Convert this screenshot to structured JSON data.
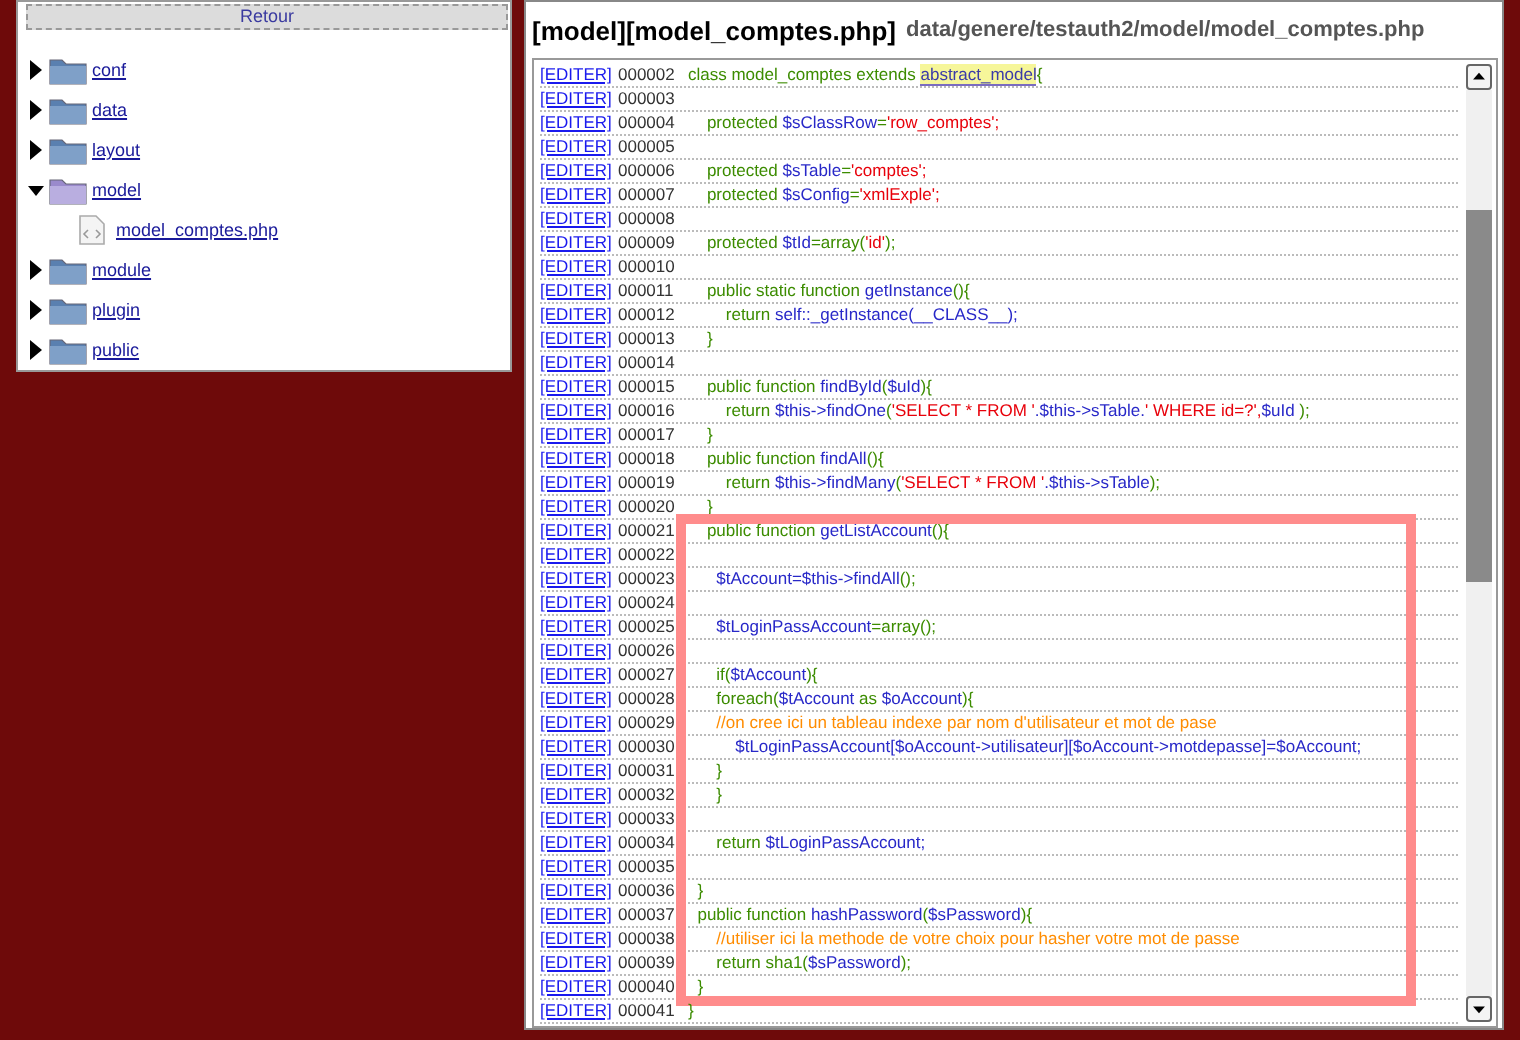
{
  "sidebar": {
    "back_button": "Retour",
    "items": [
      {
        "label": "conf",
        "kind": "folder",
        "expanded": false
      },
      {
        "label": "data",
        "kind": "folder",
        "expanded": false
      },
      {
        "label": "layout",
        "kind": "folder",
        "expanded": false
      },
      {
        "label": "model",
        "kind": "folder",
        "expanded": true,
        "children": [
          {
            "label": "model_comptes.php",
            "kind": "file"
          }
        ]
      },
      {
        "label": "module",
        "kind": "folder",
        "expanded": false
      },
      {
        "label": "plugin",
        "kind": "folder",
        "expanded": false
      },
      {
        "label": "public",
        "kind": "folder",
        "expanded": false
      }
    ]
  },
  "editor": {
    "title": "[model][model_comptes.php]",
    "path": "data/genere/testauth2/model/model_comptes.php",
    "lines": [
      {
        "edit_link": "[EDITER]",
        "number": "000002",
        "highlighted": false,
        "code": [
          {
            "text": "class model_comptes extends ",
            "color": "#3c8c00"
          },
          {
            "text": "abstract_model",
            "marked": true
          },
          {
            "text": "{",
            "color": "#3c8c00"
          }
        ]
      },
      {
        "edit_link": "[EDITER]",
        "number": "000003",
        "highlighted": false
      },
      {
        "edit_link": "[EDITER]",
        "number": "000004",
        "highlighted": false,
        "code": [
          {
            "text": "    protected ",
            "color": "#3c8c00"
          },
          {
            "text": "$sClassRow",
            "color": "#2828c8"
          },
          {
            "text": "=",
            "color": "#3c8c00"
          },
          {
            "text": "'row_comptes';",
            "color": "#e8000a"
          }
        ]
      },
      {
        "edit_link": "[EDITER]",
        "number": "000005",
        "highlighted": false
      },
      {
        "edit_link": "[EDITER]",
        "number": "000006",
        "highlighted": false,
        "code": [
          {
            "text": "    protected ",
            "color": "#3c8c00"
          },
          {
            "text": "$sTable",
            "color": "#2828c8"
          },
          {
            "text": "=",
            "color": "#3c8c00"
          },
          {
            "text": "'comptes';",
            "color": "#e8000a"
          }
        ]
      },
      {
        "edit_link": "[EDITER]",
        "number": "000007",
        "highlighted": false,
        "code": [
          {
            "text": "    protected ",
            "color": "#3c8c00"
          },
          {
            "text": "$sConfig",
            "color": "#2828c8"
          },
          {
            "text": "=",
            "color": "#3c8c00"
          },
          {
            "text": "'xmlExple';",
            "color": "#e8000a"
          }
        ]
      },
      {
        "edit_link": "[EDITER]",
        "number": "000008",
        "highlighted": false
      },
      {
        "edit_link": "[EDITER]",
        "number": "000009",
        "highlighted": false,
        "code": [
          {
            "text": "    protected ",
            "color": "#3c8c00"
          },
          {
            "text": "$tId",
            "color": "#2828c8"
          },
          {
            "text": "=array(",
            "color": "#3c8c00"
          },
          {
            "text": "'id'",
            "color": "#e8000a"
          },
          {
            "text": ");",
            "color": "#3c8c00"
          }
        ]
      },
      {
        "edit_link": "[EDITER]",
        "number": "000010",
        "highlighted": false
      },
      {
        "edit_link": "[EDITER]",
        "number": "000011",
        "highlighted": false,
        "code": [
          {
            "text": "    public static function ",
            "color": "#3c8c00"
          },
          {
            "text": "getInstance",
            "color": "#2828c8"
          },
          {
            "text": "(){",
            "color": "#3c8c00"
          }
        ]
      },
      {
        "edit_link": "[EDITER]",
        "number": "000012",
        "highlighted": false,
        "code": [
          {
            "text": "        return ",
            "color": "#3c8c00"
          },
          {
            "text": "self::_getInstance(__CLASS__);",
            "color": "#2828c8"
          }
        ]
      },
      {
        "edit_link": "[EDITER]",
        "number": "000013",
        "highlighted": false,
        "code": [
          {
            "text": "    }",
            "color": "#3c8c00"
          }
        ]
      },
      {
        "edit_link": "[EDITER]",
        "number": "000014",
        "highlighted": false
      },
      {
        "edit_link": "[EDITER]",
        "number": "000015",
        "highlighted": false,
        "code": [
          {
            "text": "    public function ",
            "color": "#3c8c00"
          },
          {
            "text": "findById",
            "color": "#2828c8"
          },
          {
            "text": "(",
            "color": "#3c8c00"
          },
          {
            "text": "$uId",
            "color": "#2828c8"
          },
          {
            "text": "){",
            "color": "#3c8c00"
          }
        ]
      },
      {
        "edit_link": "[EDITER]",
        "number": "000016",
        "highlighted": false,
        "code": [
          {
            "text": "        return ",
            "color": "#3c8c00"
          },
          {
            "text": "$this->findOne",
            "color": "#2828c8"
          },
          {
            "text": "(",
            "color": "#3c8c00"
          },
          {
            "text": "'SELECT * FROM '",
            "color": "#e8000a"
          },
          {
            "text": ".$this->sTable.",
            "color": "#2828c8"
          },
          {
            "text": "' WHERE id=?',",
            "color": "#e8000a"
          },
          {
            "text": "$uId",
            "color": "#2828c8"
          },
          {
            "text": " );",
            "color": "#3c8c00"
          }
        ]
      },
      {
        "edit_link": "[EDITER]",
        "number": "000017",
        "highlighted": false,
        "code": [
          {
            "text": "    }",
            "color": "#3c8c00"
          }
        ]
      },
      {
        "edit_link": "[EDITER]",
        "number": "000018",
        "highlighted": false,
        "code": [
          {
            "text": "    public function ",
            "color": "#3c8c00"
          },
          {
            "text": "findAll",
            "color": "#2828c8"
          },
          {
            "text": "(){",
            "color": "#3c8c00"
          }
        ]
      },
      {
        "edit_link": "[EDITER]",
        "number": "000019",
        "highlighted": false,
        "code": [
          {
            "text": "        return ",
            "color": "#3c8c00"
          },
          {
            "text": "$this->findMany",
            "color": "#2828c8"
          },
          {
            "text": "(",
            "color": "#3c8c00"
          },
          {
            "text": "'SELECT * FROM '",
            "color": "#e8000a"
          },
          {
            "text": ".$this->sTable",
            "color": "#2828c8"
          },
          {
            "text": ");",
            "color": "#3c8c00"
          }
        ]
      },
      {
        "edit_link": "[EDITER]",
        "number": "000020",
        "highlighted": false,
        "code": [
          {
            "text": "    }",
            "color": "#3c8c00"
          }
        ]
      },
      {
        "edit_link": "[EDITER]",
        "number": "000021",
        "highlighted": true,
        "code": [
          {
            "text": "    public function ",
            "color": "#3c8c00"
          },
          {
            "text": "getListAccount",
            "color": "#2828c8"
          },
          {
            "text": "(){",
            "color": "#3c8c00"
          }
        ]
      },
      {
        "edit_link": "[EDITER]",
        "number": "000022",
        "highlighted": true
      },
      {
        "edit_link": "[EDITER]",
        "number": "000023",
        "highlighted": true,
        "code": [
          {
            "text": "      $tAccount=$this->findAll",
            "color": "#2828c8"
          },
          {
            "text": "();",
            "color": "#3c8c00"
          }
        ]
      },
      {
        "edit_link": "[EDITER]",
        "number": "000024",
        "highlighted": true
      },
      {
        "edit_link": "[EDITER]",
        "number": "000025",
        "highlighted": true,
        "code": [
          {
            "text": "      $tLoginPassAccount",
            "color": "#2828c8"
          },
          {
            "text": "=array();",
            "color": "#3c8c00"
          }
        ]
      },
      {
        "edit_link": "[EDITER]",
        "number": "000026",
        "highlighted": true
      },
      {
        "edit_link": "[EDITER]",
        "number": "000027",
        "highlighted": true,
        "code": [
          {
            "text": "      if(",
            "color": "#3c8c00"
          },
          {
            "text": "$tAccount",
            "color": "#2828c8"
          },
          {
            "text": "){",
            "color": "#3c8c00"
          }
        ]
      },
      {
        "edit_link": "[EDITER]",
        "number": "000028",
        "highlighted": true,
        "code": [
          {
            "text": "      foreach(",
            "color": "#3c8c00"
          },
          {
            "text": "$tAccount",
            "color": "#2828c8"
          },
          {
            "text": " as ",
            "color": "#3c8c00"
          },
          {
            "text": "$oAccount",
            "color": "#2828c8"
          },
          {
            "text": "){",
            "color": "#3c8c00"
          }
        ]
      },
      {
        "edit_link": "[EDITER]",
        "number": "000029",
        "highlighted": true,
        "code": [
          {
            "text": "      //on cree ici un tableau indexe par nom d'utilisateur et mot de pase",
            "color": "#ff8c00"
          }
        ]
      },
      {
        "edit_link": "[EDITER]",
        "number": "000030",
        "highlighted": true,
        "code": [
          {
            "text": "          $tLoginPassAccount[$oAccount->utilisateur][$oAccount->motdepasse]=$oAccount;",
            "color": "#2828c8"
          }
        ]
      },
      {
        "edit_link": "[EDITER]",
        "number": "000031",
        "highlighted": true,
        "code": [
          {
            "text": "      }",
            "color": "#3c8c00"
          }
        ]
      },
      {
        "edit_link": "[EDITER]",
        "number": "000032",
        "highlighted": true,
        "code": [
          {
            "text": "      }",
            "color": "#3c8c00"
          }
        ]
      },
      {
        "edit_link": "[EDITER]",
        "number": "000033",
        "highlighted": true
      },
      {
        "edit_link": "[EDITER]",
        "number": "000034",
        "highlighted": true,
        "code": [
          {
            "text": "      return ",
            "color": "#3c8c00"
          },
          {
            "text": "$tLoginPassAccount;",
            "color": "#2828c8"
          }
        ]
      },
      {
        "edit_link": "[EDITER]",
        "number": "000035",
        "highlighted": true
      },
      {
        "edit_link": "[EDITER]",
        "number": "000036",
        "highlighted": true,
        "code": [
          {
            "text": "  }",
            "color": "#3c8c00"
          }
        ]
      },
      {
        "edit_link": "[EDITER]",
        "number": "000037",
        "highlighted": true,
        "code": [
          {
            "text": "  public function ",
            "color": "#3c8c00"
          },
          {
            "text": "hashPassword",
            "color": "#2828c8"
          },
          {
            "text": "(",
            "color": "#3c8c00"
          },
          {
            "text": "$sPassword",
            "color": "#2828c8"
          },
          {
            "text": "){",
            "color": "#3c8c00"
          }
        ]
      },
      {
        "edit_link": "[EDITER]",
        "number": "000038",
        "highlighted": true,
        "code": [
          {
            "text": "      //utiliser ici la methode de votre choix pour hasher votre mot de passe",
            "color": "#ff8c00"
          }
        ]
      },
      {
        "edit_link": "[EDITER]",
        "number": "000039",
        "highlighted": true,
        "code": [
          {
            "text": "      return sha1(",
            "color": "#3c8c00"
          },
          {
            "text": "$sPassword",
            "color": "#2828c8"
          },
          {
            "text": ");",
            "color": "#3c8c00"
          }
        ]
      },
      {
        "edit_link": "[EDITER]",
        "number": "000040",
        "highlighted": true,
        "code": [
          {
            "text": "  }",
            "color": "#3c8c00"
          }
        ]
      },
      {
        "edit_link": "[EDITER]",
        "number": "000041",
        "highlighted": false,
        "code": [
          {
            "text": "}",
            "color": "#3c8c00"
          }
        ]
      }
    ]
  }
}
